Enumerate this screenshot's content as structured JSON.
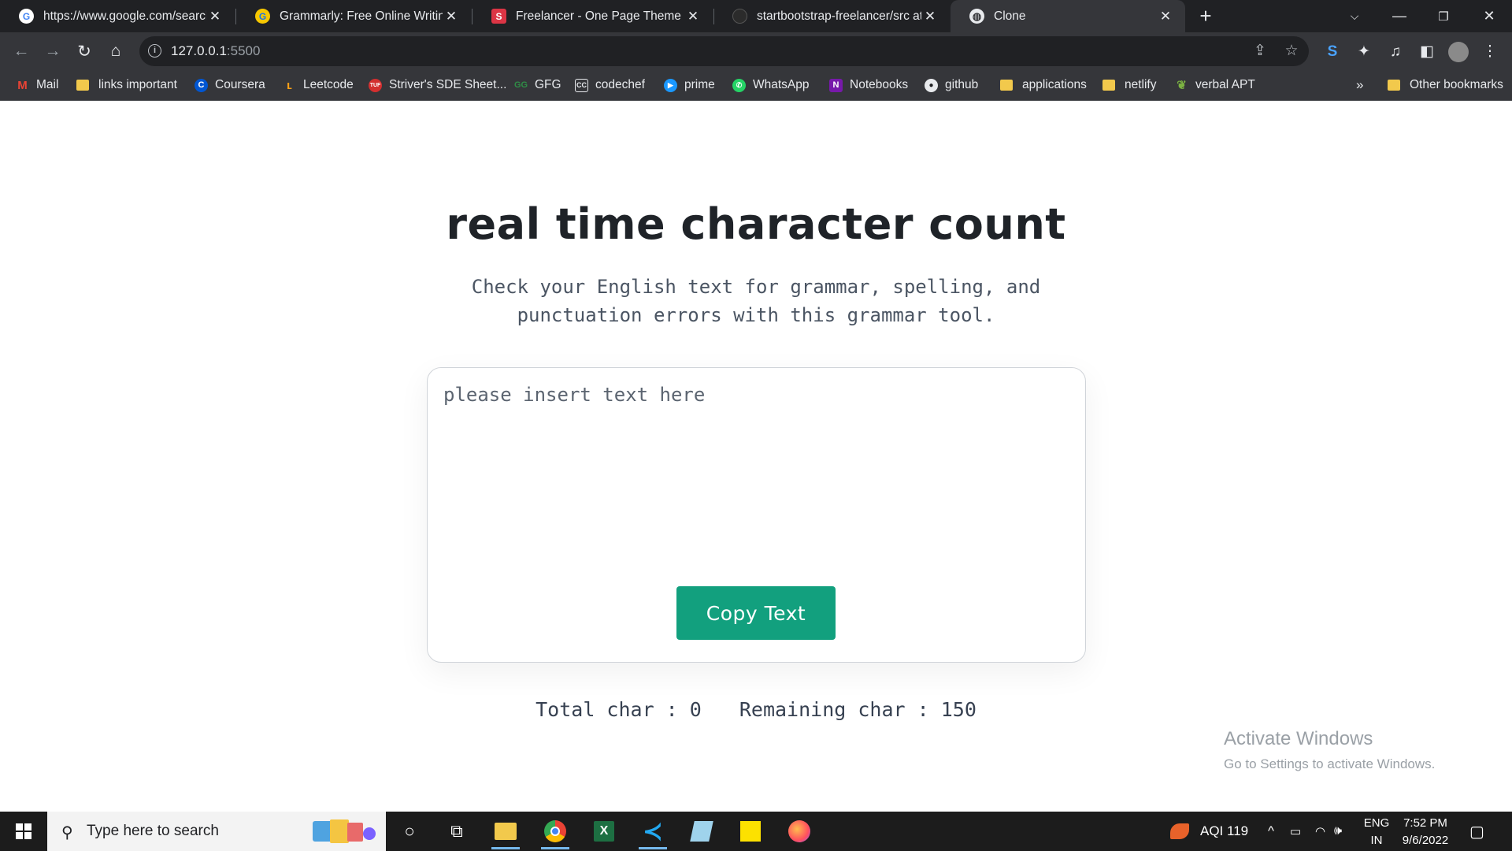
{
  "browser": {
    "tabs": [
      {
        "title": "https://www.google.com/search?",
        "favicon": "google-icon"
      },
      {
        "title": "Grammarly: Free Online Writing A",
        "favicon": "grammarly-icon"
      },
      {
        "title": "Freelancer - One Page Theme - S",
        "favicon": "startbootstrap-icon"
      },
      {
        "title": "startbootstrap-freelancer/src at m",
        "favicon": "github-icon"
      },
      {
        "title": "Clone",
        "favicon": "globe-icon"
      }
    ],
    "address_bar": {
      "host": "127.0.0.1",
      "port": ":5500"
    },
    "bookmarks": [
      {
        "label": "Mail",
        "icon": "gmail-icon"
      },
      {
        "label": "links important",
        "icon": "folder-icon"
      },
      {
        "label": "Coursera",
        "icon": "coursera-icon"
      },
      {
        "label": "Leetcode",
        "icon": "leetcode-icon"
      },
      {
        "label": "Striver's SDE Sheet...",
        "icon": "tuf-icon"
      },
      {
        "label": "GFG",
        "icon": "gfg-icon"
      },
      {
        "label": "codechef",
        "icon": "codechef-icon"
      },
      {
        "label": "prime",
        "icon": "prime-icon"
      },
      {
        "label": "WhatsApp",
        "icon": "whatsapp-icon"
      },
      {
        "label": "Notebooks",
        "icon": "onenote-icon"
      },
      {
        "label": "github",
        "icon": "github-icon"
      },
      {
        "label": "applications",
        "icon": "folder-icon"
      },
      {
        "label": "netlify",
        "icon": "folder-icon"
      },
      {
        "label": "verbal APT",
        "icon": "leaf-icon"
      }
    ],
    "bookmarks_overflow": "»",
    "other_bookmarks": "Other bookmarks"
  },
  "page": {
    "title": "real time character count",
    "subtitle": "Check your English text for grammar, spelling, and punctuation errors with this grammar tool.",
    "textarea_placeholder": "please insert text here",
    "copy_button": "Copy Text",
    "total_label": "Total char : ",
    "total_value": "0",
    "remaining_label": "Remaining char : ",
    "remaining_value": "150",
    "accent_color": "#12a07e"
  },
  "watermark": {
    "line1": "Activate Windows",
    "line2": "Go to Settings to activate Windows."
  },
  "taskbar": {
    "search_placeholder": "Type here to search",
    "aqi": "AQI 119",
    "lang": "ENG",
    "region": "IN",
    "time": "7:52 PM",
    "date": "9/6/2022"
  }
}
